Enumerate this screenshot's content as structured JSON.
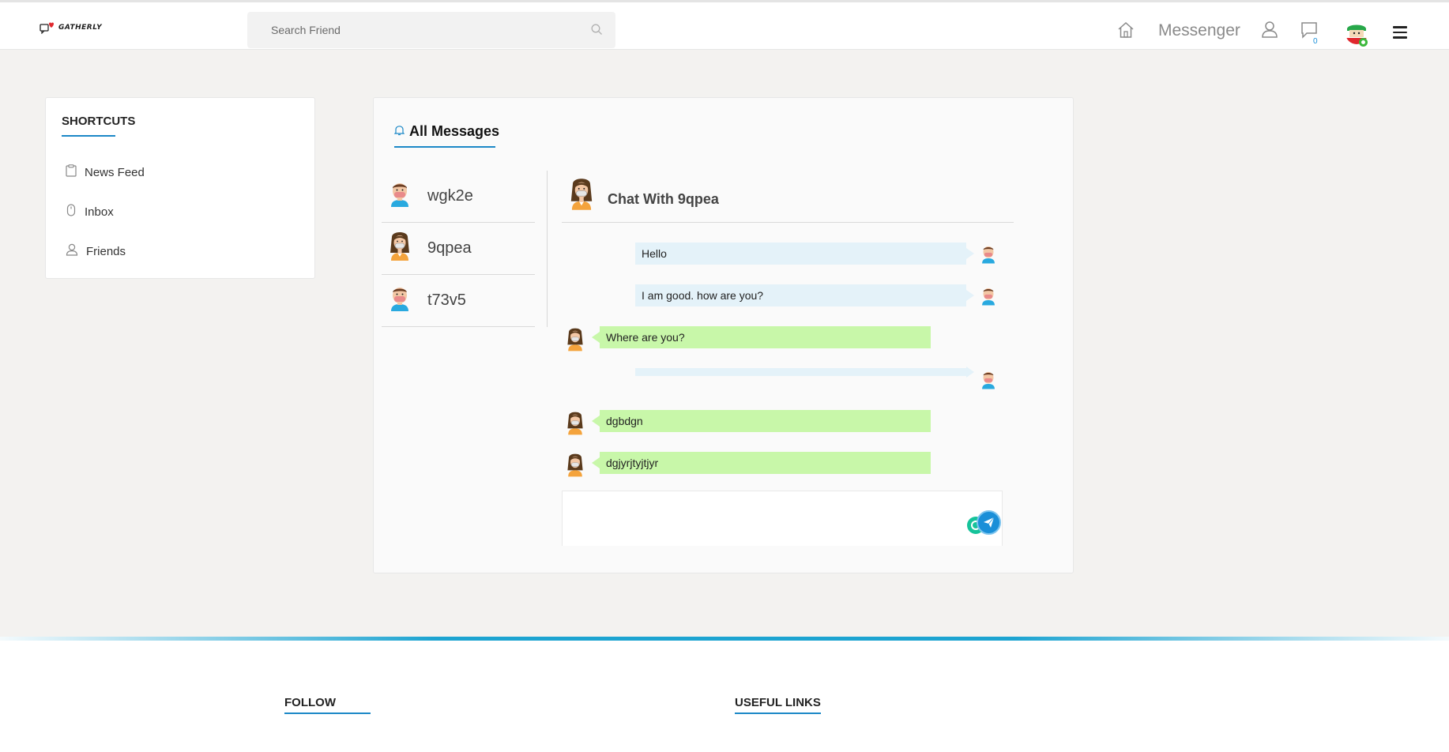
{
  "app": {
    "logo_text": "GATHERLY"
  },
  "header": {
    "search_placeholder": "Search Friend",
    "messenger_label": "Messenger",
    "chat_count": "0"
  },
  "shortcuts": {
    "title": "SHORTCUTS",
    "items": [
      {
        "label": "News Feed",
        "icon": "clipboard-icon"
      },
      {
        "label": "Inbox",
        "icon": "mouse-icon"
      },
      {
        "label": "Friends",
        "icon": "user-icon"
      }
    ]
  },
  "messages": {
    "title": "All Messages",
    "friends": [
      {
        "name": "wgk2e",
        "avatar": "male-avatar"
      },
      {
        "name": "9qpea",
        "avatar": "female-avatar"
      },
      {
        "name": "t73v5",
        "avatar": "male-avatar"
      }
    ],
    "chat_title": "Chat With 9qpea",
    "conversation": [
      {
        "direction": "out",
        "text": "Hello"
      },
      {
        "direction": "out",
        "text": "I am good. how are you?"
      },
      {
        "direction": "in",
        "text": "Where are you?"
      },
      {
        "direction": "out",
        "text": ""
      },
      {
        "direction": "in",
        "text": "dgbdgn"
      },
      {
        "direction": "in",
        "text": "dgjyrjtyjtjyr"
      }
    ],
    "composer_value": ""
  },
  "footer": {
    "follow_title": "FOLLOW",
    "links_title": "USEFUL LINKS"
  },
  "colors": {
    "accent": "#1c88c7",
    "outgoing_bubble": "#e4f2f9",
    "incoming_bubble": "#c8f7a9",
    "online": "#3cb83c"
  }
}
